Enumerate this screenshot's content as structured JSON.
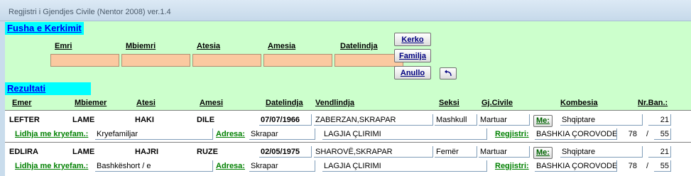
{
  "window": {
    "title": "Regjistri i Gjendjes Civile (Nentor 2008) ver.1.4"
  },
  "search": {
    "section_title": "Fusha e Kerkimit",
    "fields": [
      {
        "label": "Emri",
        "value": ""
      },
      {
        "label": "Mbiemri",
        "value": ""
      },
      {
        "label": "Atesia",
        "value": ""
      },
      {
        "label": "Amesia",
        "value": ""
      },
      {
        "label": "Datelindja",
        "value": ""
      }
    ],
    "buttons": {
      "search": "Kerko",
      "family": "Familja",
      "cancel": "Anullo"
    },
    "undo_icon": "undo-arrow-icon"
  },
  "results": {
    "section_title": "Rezultati",
    "headers": [
      "Emer",
      "Mbiemer",
      "Atesi",
      "Amesi",
      "Datelindja",
      "Vendlindja",
      "Seksi",
      "Gj.Civile",
      "Kombesia",
      "Nr.Ban.:"
    ],
    "labels": {
      "family_link": "Lidhja me kryefam.:",
      "address": "Adresa:",
      "registry": "Regjistri:",
      "me_button": "Me:"
    },
    "rows": [
      {
        "emer": "LEFTER",
        "mbiemer": "LAME",
        "atesi": "HAKI",
        "amesi": "DILE",
        "datelindja": "07/07/1966",
        "vendlindja": "ZABERZAN,SKRAPAR",
        "seksi": "Mashkull",
        "gj_civile": "Martuar",
        "kombesia": "Shqiptare",
        "nr_ban": "21",
        "lidhja": "Kryefamiljar",
        "adresa": "Skrapar",
        "lagjia": "LAGJIA ÇLIRIMI",
        "regjistri": "BASHKIA ÇOROVODE",
        "reg_num": "78",
        "reg_total": "55"
      },
      {
        "emer": "EDLIRA",
        "mbiemer": "LAME",
        "atesi": "HAJRI",
        "amesi": "RUZE",
        "datelindja": "02/05/1975",
        "vendlindja": "SHAROVË,SKRAPAR",
        "seksi": "Femër",
        "gj_civile": "Martuar",
        "kombesia": "Shqiptare",
        "nr_ban": "21",
        "lidhja": "Bashkëshort / e",
        "adresa": "Skrapar",
        "lagjia": "LAGJIA ÇLIRIMI",
        "regjistri": "BASHKIA ÇOROVODE",
        "reg_num": "78",
        "reg_total": "55"
      }
    ]
  }
}
